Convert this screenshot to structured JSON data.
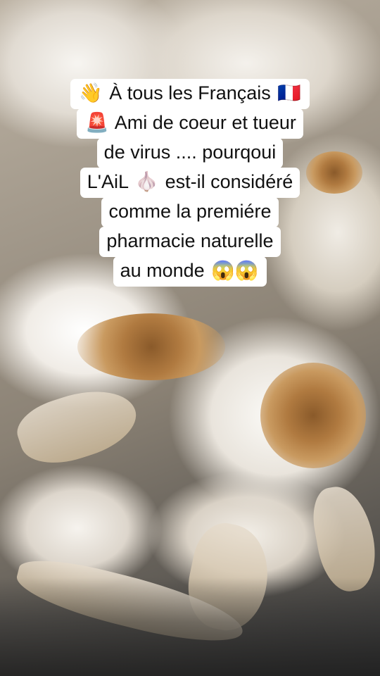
{
  "caption": {
    "lines": [
      {
        "emoji": "👋",
        "text": "À tous les Français",
        "emoji_after": "🇫🇷"
      },
      {
        "emoji": "🚨",
        "text": "Ami de coeur et tueur",
        "emoji_after": ""
      },
      {
        "emoji": "",
        "text": "de virus .... pourqoui",
        "emoji_after": ""
      },
      {
        "emoji": "",
        "text": "L'AiL",
        "emoji_mid": "🧄",
        "text_after": "est-il considéré"
      },
      {
        "emoji": "",
        "text": "comme la premiére",
        "emoji_after": ""
      },
      {
        "emoji": "",
        "text": "pharmacie naturelle",
        "emoji_after": ""
      },
      {
        "emoji": "",
        "text": "au monde",
        "emoji_after": "😱😱"
      }
    ]
  },
  "background": {
    "subject": "garlic bulbs photo",
    "colors": {
      "bulb": "#f4f1ec",
      "root": "#a06a34",
      "shadow": "#3a3a3a"
    }
  },
  "icons": [
    "waving-hand-icon",
    "police-light-icon",
    "france-flag-icon",
    "garlic-icon",
    "screaming-face-icon"
  ]
}
